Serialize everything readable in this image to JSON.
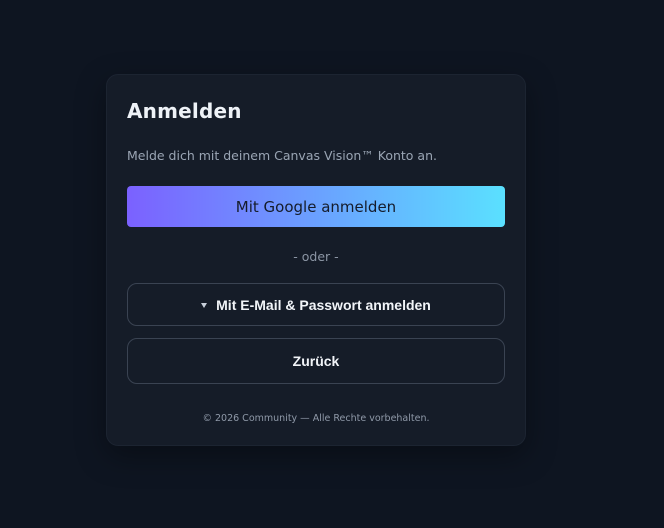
{
  "login": {
    "title": "Anmelden",
    "subtitle": "Melde dich mit deinem Canvas Vision™ Konto an.",
    "google_button": "Mit Google anmelden",
    "divider": "- oder -",
    "email_button": "Mit E-Mail & Passwort anmelden",
    "email_button_icon": "caret-down-icon",
    "back_button": "Zurück",
    "footer": "© 2026 Community — Alle Rechte vorbehalten."
  },
  "colors": {
    "background": "#0e1521",
    "card": "#151c28",
    "gradient_start": "#7b61ff",
    "gradient_end": "#5ae0ff",
    "button_border": "#3a4352"
  }
}
